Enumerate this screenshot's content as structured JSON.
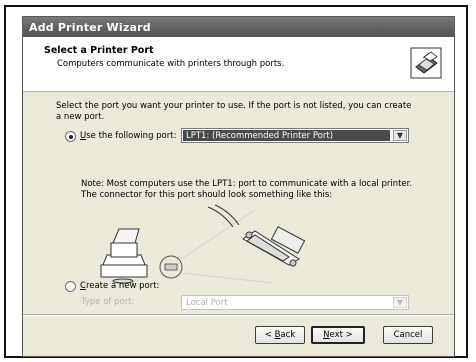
{
  "window": {
    "title": "Add Printer Wizard"
  },
  "header": {
    "title": "Select a Printer Port",
    "subtitle": "Computers communicate with printers through ports.",
    "icon": "printer-wizard-icon"
  },
  "content": {
    "intro": "Select the port you want your printer to use.  If the port is not listed, you can create a new port.",
    "use_port": {
      "label_prefix": "",
      "label_underlined": "U",
      "label_rest": "se the following port:",
      "selected": true,
      "dropdown_value": "LPT1: (Recommended Printer Port)"
    },
    "note": "Note: Most computers use the LPT1: port to communicate with a local printer. The connector for this port should look something like this:",
    "create_port": {
      "label_underlined": "C",
      "label_rest": "reate a new port:",
      "selected": false,
      "type_label": "Type of port:",
      "dropdown_value": "Local Port"
    }
  },
  "buttons": {
    "back_prefix": "< ",
    "back_underlined": "B",
    "back_rest": "ack",
    "next_underlined": "N",
    "next_rest": "ext >",
    "cancel": "Cancel"
  }
}
